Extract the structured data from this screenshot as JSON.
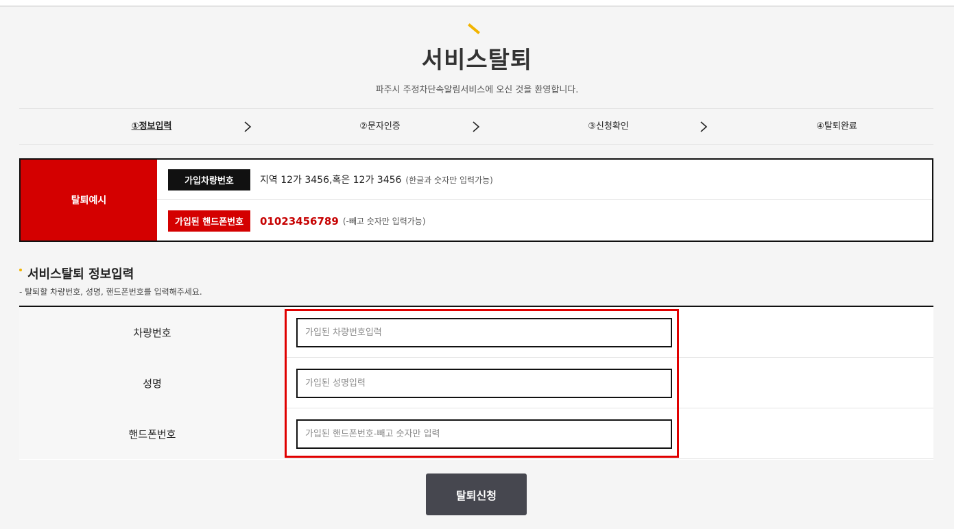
{
  "header": {
    "title": "서비스탈퇴",
    "subtitle": "파주시 주정차단속알림서비스에 오신 것을 환영합니다."
  },
  "steps": [
    {
      "label": "①정보입력",
      "active": true
    },
    {
      "label": "②문자인증",
      "active": false
    },
    {
      "label": "③신청확인",
      "active": false
    },
    {
      "label": "④탈퇴완료",
      "active": false
    }
  ],
  "example": {
    "heading": "탈퇴예시",
    "vehicle": {
      "tag": "가입차량번호",
      "value": "지역 12가 3456,혹은 12가 3456",
      "note": "(한글과 숫자만 입력가능)"
    },
    "phone": {
      "tag": "가입된 핸드폰번호",
      "value": "01023456789",
      "note": "(-빼고 숫자만 입력가능)"
    }
  },
  "form": {
    "title": "서비스탈퇴 정보입력",
    "description": "-  탈퇴할 차량번호, 성명, 핸드폰번호를 입력해주세요.",
    "fields": [
      {
        "label": "차량번호",
        "placeholder": "가입된 차량번호입력",
        "value": ""
      },
      {
        "label": "성명",
        "placeholder": "가입된 성명입력",
        "value": ""
      },
      {
        "label": "핸드폰번호",
        "placeholder": "가입된 핸드폰번호-빼고 숫자만 입력",
        "value": ""
      }
    ],
    "submit_label": "탈퇴신청"
  },
  "colors": {
    "accent": "#f2b400",
    "red": "#d40000",
    "button": "#46474f"
  }
}
